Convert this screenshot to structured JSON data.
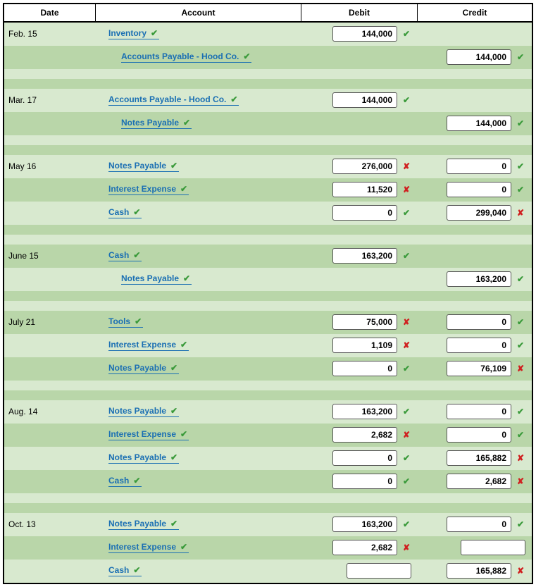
{
  "headers": {
    "date": "Date",
    "account": "Account",
    "debit": "Debit",
    "credit": "Credit"
  },
  "rows": [
    {
      "type": "data",
      "shade": "light",
      "date": "Feb. 15",
      "account": "Inventory",
      "acctMark": "ok",
      "indent": false,
      "debit": "144,000",
      "debitMark": "ok",
      "credit": null,
      "creditMark": null
    },
    {
      "type": "data",
      "shade": "dark",
      "date": "",
      "account": "Accounts Payable - Hood Co.",
      "acctMark": "ok",
      "indent": true,
      "debit": null,
      "debitMark": null,
      "credit": "144,000",
      "creditMark": "ok"
    },
    {
      "type": "spacer",
      "shade": "light"
    },
    {
      "type": "spacer",
      "shade": "dark"
    },
    {
      "type": "data",
      "shade": "light",
      "date": "Mar. 17",
      "account": "Accounts Payable - Hood Co.",
      "acctMark": "ok",
      "indent": false,
      "debit": "144,000",
      "debitMark": "ok",
      "credit": null,
      "creditMark": null
    },
    {
      "type": "data",
      "shade": "dark",
      "date": "",
      "account": "Notes Payable",
      "acctMark": "ok",
      "indent": true,
      "debit": null,
      "debitMark": null,
      "credit": "144,000",
      "creditMark": "ok"
    },
    {
      "type": "spacer",
      "shade": "light"
    },
    {
      "type": "spacer",
      "shade": "dark"
    },
    {
      "type": "data",
      "shade": "light",
      "date": "May 16",
      "account": "Notes Payable",
      "acctMark": "ok",
      "indent": false,
      "debit": "276,000",
      "debitMark": "bad",
      "credit": "0",
      "creditMark": "ok"
    },
    {
      "type": "data",
      "shade": "dark",
      "date": "",
      "account": "Interest Expense",
      "acctMark": "ok",
      "indent": false,
      "debit": "11,520",
      "debitMark": "bad",
      "credit": "0",
      "creditMark": "ok"
    },
    {
      "type": "data",
      "shade": "light",
      "date": "",
      "account": "Cash",
      "acctMark": "ok",
      "indent": false,
      "debit": "0",
      "debitMark": "ok",
      "credit": "299,040",
      "creditMark": "bad"
    },
    {
      "type": "spacer",
      "shade": "dark"
    },
    {
      "type": "spacer",
      "shade": "light"
    },
    {
      "type": "data",
      "shade": "dark",
      "date": "June 15",
      "account": "Cash",
      "acctMark": "ok",
      "indent": false,
      "debit": "163,200",
      "debitMark": "ok",
      "credit": null,
      "creditMark": null
    },
    {
      "type": "data",
      "shade": "light",
      "date": "",
      "account": "Notes Payable",
      "acctMark": "ok",
      "indent": true,
      "debit": null,
      "debitMark": null,
      "credit": "163,200",
      "creditMark": "ok"
    },
    {
      "type": "spacer",
      "shade": "dark"
    },
    {
      "type": "spacer",
      "shade": "light"
    },
    {
      "type": "data",
      "shade": "dark",
      "date": "July 21",
      "account": "Tools",
      "acctMark": "ok",
      "indent": false,
      "debit": "75,000",
      "debitMark": "bad",
      "credit": "0",
      "creditMark": "ok"
    },
    {
      "type": "data",
      "shade": "light",
      "date": "",
      "account": "Interest Expense",
      "acctMark": "ok",
      "indent": false,
      "debit": "1,109",
      "debitMark": "bad",
      "credit": "0",
      "creditMark": "ok"
    },
    {
      "type": "data",
      "shade": "dark",
      "date": "",
      "account": "Notes Payable",
      "acctMark": "ok",
      "indent": false,
      "debit": "0",
      "debitMark": "ok",
      "credit": "76,109",
      "creditMark": "bad"
    },
    {
      "type": "spacer",
      "shade": "light"
    },
    {
      "type": "spacer",
      "shade": "dark"
    },
    {
      "type": "data",
      "shade": "light",
      "date": "Aug. 14",
      "account": "Notes Payable",
      "acctMark": "ok",
      "indent": false,
      "debit": "163,200",
      "debitMark": "ok",
      "credit": "0",
      "creditMark": "ok"
    },
    {
      "type": "data",
      "shade": "dark",
      "date": "",
      "account": "Interest Expense",
      "acctMark": "ok",
      "indent": false,
      "debit": "2,682",
      "debitMark": "bad",
      "credit": "0",
      "creditMark": "ok"
    },
    {
      "type": "data",
      "shade": "light",
      "date": "",
      "account": "Notes Payable",
      "acctMark": "ok",
      "indent": false,
      "debit": "0",
      "debitMark": "ok",
      "credit": "165,882",
      "creditMark": "bad"
    },
    {
      "type": "data",
      "shade": "dark",
      "date": "",
      "account": "Cash",
      "acctMark": "ok",
      "indent": false,
      "debit": "0",
      "debitMark": "ok",
      "credit": "2,682",
      "creditMark": "bad"
    },
    {
      "type": "spacer",
      "shade": "light"
    },
    {
      "type": "spacer",
      "shade": "dark"
    },
    {
      "type": "data",
      "shade": "light",
      "date": "Oct. 13",
      "account": "Notes Payable",
      "acctMark": "ok",
      "indent": false,
      "debit": "163,200",
      "debitMark": "ok",
      "credit": "0",
      "creditMark": "ok"
    },
    {
      "type": "data",
      "shade": "dark",
      "date": "",
      "account": "Interest Expense",
      "acctMark": "ok",
      "indent": false,
      "debit": "2,682",
      "debitMark": "bad",
      "credit": "",
      "creditMark": null
    },
    {
      "type": "data",
      "shade": "light",
      "date": "",
      "account": "Cash",
      "acctMark": "ok",
      "indent": false,
      "debit": "",
      "debitMark": null,
      "credit": "165,882",
      "creditMark": "bad"
    }
  ]
}
